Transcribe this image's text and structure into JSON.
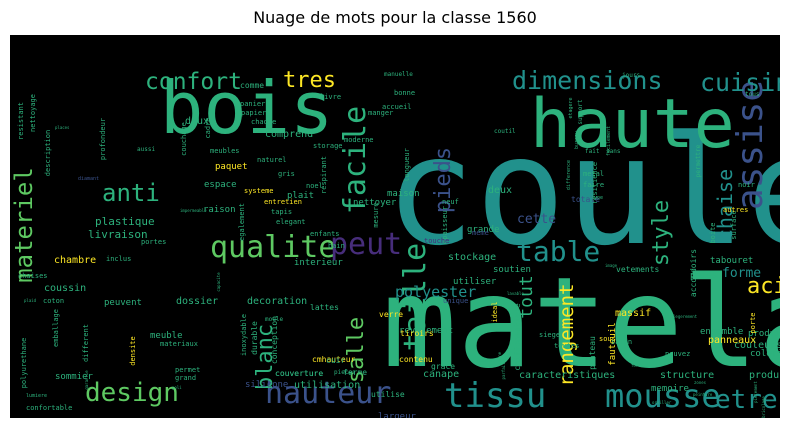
{
  "chart_data": {
    "type": "wordcloud",
    "title": "Nuage de mots pour la classe 1560",
    "background": "#000000",
    "palette": [
      "#2db27d",
      "#21918c",
      "#3b528b",
      "#fde725",
      "#5ec962",
      "#472d7b",
      "#440154"
    ],
    "words": [
      {
        "text": "couleur",
        "weight": 100,
        "color": "#21918c"
      },
      {
        "text": "matelas",
        "weight": 98,
        "color": "#2db27d"
      },
      {
        "text": "bois",
        "weight": 62,
        "color": "#2db27d"
      },
      {
        "text": "haute",
        "weight": 58,
        "color": "#2db27d"
      },
      {
        "text": "tissu",
        "weight": 34,
        "color": "#21918c"
      },
      {
        "text": "mousse",
        "weight": 32,
        "color": "#21918c"
      },
      {
        "text": "hauteur",
        "weight": 30,
        "color": "#3b528b"
      },
      {
        "text": "qualite",
        "weight": 28,
        "color": "#5ec962"
      },
      {
        "text": "table",
        "weight": 28,
        "color": "#21918c"
      },
      {
        "text": "assise",
        "weight": 27,
        "color": "#3b528b"
      },
      {
        "text": "peut",
        "weight": 27,
        "color": "#472d7b"
      },
      {
        "text": "design",
        "weight": 26,
        "color": "#5ec962"
      },
      {
        "text": "etre",
        "weight": 26,
        "color": "#21918c"
      },
      {
        "text": "facile",
        "weight": 24,
        "color": "#2db27d"
      },
      {
        "text": "taille",
        "weight": 24,
        "color": "#2db27d"
      },
      {
        "text": "dimensions",
        "weight": 23,
        "color": "#21918c"
      },
      {
        "text": "cuisine",
        "weight": 23,
        "color": "#21918c"
      },
      {
        "text": "materiel",
        "weight": 22,
        "color": "#5ec962"
      },
      {
        "text": "confort",
        "weight": 21,
        "color": "#2db27d"
      },
      {
        "text": "anti",
        "weight": 21,
        "color": "#2db27d"
      },
      {
        "text": "tres",
        "weight": 21,
        "color": "#fde725"
      },
      {
        "text": "blanc",
        "weight": 20,
        "color": "#2db27d"
      },
      {
        "text": "pieds",
        "weight": 20,
        "color": "#3b528b"
      },
      {
        "text": "salle",
        "weight": 20,
        "color": "#5ec962"
      },
      {
        "text": "acier",
        "weight": 20,
        "color": "#fde725"
      },
      {
        "text": "chaise",
        "weight": 19,
        "color": "#21918c"
      },
      {
        "text": "style",
        "weight": 19,
        "color": "#2db27d"
      },
      {
        "text": "rangement",
        "weight": 18,
        "color": "#fde725"
      },
      {
        "text": "tout",
        "weight": 17,
        "color": "#2db27d"
      },
      {
        "text": "polyester",
        "weight": 14,
        "color": "#21918c"
      },
      {
        "text": "forme",
        "weight": 14,
        "color": "#21918c"
      },
      {
        "text": "cette",
        "weight": 12,
        "color": "#3b528b"
      },
      {
        "text": "plastique",
        "weight": 10,
        "color": "#2db27d"
      },
      {
        "text": "livraison",
        "weight": 10,
        "color": "#2db27d"
      },
      {
        "text": "couleurs",
        "weight": 9,
        "color": "#2db27d"
      },
      {
        "text": "stockage",
        "weight": 9,
        "color": "#2db27d"
      },
      {
        "text": "deux",
        "weight": 9,
        "color": "#2db27d"
      },
      {
        "text": "chambre",
        "weight": 9,
        "color": "#fde725"
      },
      {
        "text": "coussin",
        "weight": 8,
        "color": "#2db27d"
      },
      {
        "text": "comprend",
        "weight": 8,
        "color": "#2db27d"
      },
      {
        "text": "doux",
        "weight": 8,
        "color": "#2db27d"
      },
      {
        "text": "decoration",
        "weight": 8,
        "color": "#2db27d"
      },
      {
        "text": "dossier",
        "weight": 8,
        "color": "#2db27d"
      },
      {
        "text": "produits",
        "weight": 8,
        "color": "#2db27d"
      },
      {
        "text": "structure",
        "weight": 8,
        "color": "#2db27d"
      },
      {
        "text": "caracteristiques",
        "weight": 8,
        "color": "#2db27d"
      },
      {
        "text": "canape",
        "weight": 8,
        "color": "#2db27d"
      },
      {
        "text": "utilisation",
        "weight": 8,
        "color": "#2db27d"
      },
      {
        "text": "memoire",
        "weight": 7,
        "color": "#2db27d"
      },
      {
        "text": "largeur",
        "weight": 7,
        "color": "#3b528b"
      },
      {
        "text": "silicone",
        "weight": 7,
        "color": "#3b528b"
      },
      {
        "text": "revetement",
        "weight": 7,
        "color": "#2db27d"
      },
      {
        "text": "massif",
        "weight": 7,
        "color": "#fde725"
      },
      {
        "text": "panneaux",
        "weight": 7,
        "color": "#fde725"
      },
      {
        "text": "tabouret",
        "weight": 7,
        "color": "#2db27d"
      },
      {
        "text": "meuble",
        "weight": 7,
        "color": "#2db27d"
      },
      {
        "text": "grande",
        "weight": 7,
        "color": "#2db27d"
      },
      {
        "text": "ensemble",
        "weight": 7,
        "color": "#2db27d"
      },
      {
        "text": "coloris",
        "weight": 6,
        "color": "#2db27d"
      },
      {
        "text": "produit",
        "weight": 6,
        "color": "#2db27d"
      },
      {
        "text": "comme",
        "weight": 6,
        "color": "#2db27d"
      },
      {
        "text": "plait",
        "weight": 6,
        "color": "#2db27d"
      },
      {
        "text": "espace",
        "weight": 6,
        "color": "#2db27d"
      },
      {
        "text": "raison",
        "weight": 6,
        "color": "#2db27d"
      },
      {
        "text": "paquet",
        "weight": 6,
        "color": "#fde725"
      },
      {
        "text": "interieur",
        "weight": 6,
        "color": "#2db27d"
      },
      {
        "text": "poids",
        "weight": 6,
        "color": "#2db27d"
      },
      {
        "text": "utiliser",
        "weight": 6,
        "color": "#2db27d"
      },
      {
        "text": "soutien",
        "weight": 6,
        "color": "#2db27d"
      },
      {
        "text": "maison",
        "weight": 6,
        "color": "#2db27d"
      },
      {
        "text": "nettoyer",
        "weight": 6,
        "color": "#2db27d"
      },
      {
        "text": "peuvent",
        "weight": 6,
        "color": "#2db27d"
      },
      {
        "text": "sommier",
        "weight": 6,
        "color": "#2db27d"
      },
      {
        "text": "contenu",
        "weight": 6,
        "color": "#fde725"
      },
      {
        "text": "tiroirs",
        "weight": 6,
        "color": "#fde725"
      },
      {
        "text": "cmhauteur",
        "weight": 6,
        "color": "#fde725"
      },
      {
        "text": "couverture",
        "weight": 6,
        "color": "#2db27d"
      },
      {
        "text": "conception",
        "weight": 6,
        "color": "#2db27d"
      },
      {
        "text": "durable",
        "weight": 6,
        "color": "#2db27d"
      },
      {
        "text": "lattes",
        "weight": 5,
        "color": "#2db27d"
      },
      {
        "text": "verre",
        "weight": 5,
        "color": "#fde725"
      },
      {
        "text": "cuir",
        "weight": 5,
        "color": "#2db27d"
      },
      {
        "text": "grace",
        "weight": 5,
        "color": "#2db27d"
      },
      {
        "text": "ferme",
        "weight": 5,
        "color": "#2db27d"
      },
      {
        "text": "utilise",
        "weight": 5,
        "color": "#2db27d"
      },
      {
        "text": "fauteuil",
        "weight": 5,
        "color": "#fde725"
      },
      {
        "text": "plateau",
        "weight": 5,
        "color": "#2db27d"
      },
      {
        "text": "accoudoirs",
        "weight": 5,
        "color": "#2db27d"
      },
      {
        "text": "vetements",
        "weight": 5,
        "color": "#2db27d"
      },
      {
        "text": "chiffonmatiere",
        "weight": 5,
        "color": "#2db27d"
      },
      {
        "text": "nettoyage",
        "weight": 4,
        "color": "#2db27d"
      },
      {
        "text": "resistant",
        "weight": 4,
        "color": "#2db27d"
      },
      {
        "text": "description",
        "weight": 4,
        "color": "#2db27d"
      },
      {
        "text": "profondeur",
        "weight": 4,
        "color": "#2db27d"
      },
      {
        "text": "couchage",
        "weight": 4,
        "color": "#2db27d"
      },
      {
        "text": "cadre",
        "weight": 4,
        "color": "#2db27d"
      },
      {
        "text": "panier",
        "weight": 4,
        "color": "#2db27d"
      },
      {
        "text": "papier",
        "weight": 4,
        "color": "#2db27d"
      },
      {
        "text": "chaque",
        "weight": 4,
        "color": "#2db27d"
      },
      {
        "text": "livre",
        "weight": 4,
        "color": "#2db27d"
      },
      {
        "text": "manger",
        "weight": 4,
        "color": "#2db27d"
      },
      {
        "text": "bonne",
        "weight": 4,
        "color": "#2db27d"
      },
      {
        "text": "accueil",
        "weight": 4,
        "color": "#2db27d"
      },
      {
        "text": "moderne",
        "weight": 4,
        "color": "#2db27d"
      },
      {
        "text": "storage",
        "weight": 4,
        "color": "#2db27d"
      },
      {
        "text": "respirant",
        "weight": 4,
        "color": "#2db27d"
      },
      {
        "text": "longueur",
        "weight": 4,
        "color": "#2db27d"
      },
      {
        "text": "mesure",
        "weight": 4,
        "color": "#2db27d"
      },
      {
        "text": "epaisseur",
        "weight": 4,
        "color": "#2db27d"
      },
      {
        "text": "resilience",
        "weight": 4,
        "color": "#2db27d"
      },
      {
        "text": "metal",
        "weight": 4,
        "color": "#2db27d"
      },
      {
        "text": "faire",
        "weight": 4,
        "color": "#2db27d"
      },
      {
        "text": "totale",
        "weight": 4,
        "color": "#3b528b"
      },
      {
        "text": "noir",
        "weight": 4,
        "color": "#2db27d"
      },
      {
        "text": "surface",
        "weight": 4,
        "color": "#2db27d"
      },
      {
        "text": "boite",
        "weight": 4,
        "color": "#2db27d"
      },
      {
        "text": "autres",
        "weight": 4,
        "color": "#fde725"
      },
      {
        "text": "meubles",
        "weight": 4,
        "color": "#2db27d"
      },
      {
        "text": "naturel",
        "weight": 4,
        "color": "#2db27d"
      },
      {
        "text": "gris",
        "weight": 4,
        "color": "#2db27d"
      },
      {
        "text": "noel",
        "weight": 4,
        "color": "#2db27d"
      },
      {
        "text": "systeme",
        "weight": 4,
        "color": "#fde725"
      },
      {
        "text": "entretien",
        "weight": 4,
        "color": "#fde725"
      },
      {
        "text": "tapis",
        "weight": 4,
        "color": "#2db27d"
      },
      {
        "text": "elegant",
        "weight": 4,
        "color": "#2db27d"
      },
      {
        "text": "enfants",
        "weight": 4,
        "color": "#2db27d"
      },
      {
        "text": "bain",
        "weight": 4,
        "color": "#2db27d"
      },
      {
        "text": "neuf",
        "weight": 4,
        "color": "#2db27d"
      },
      {
        "text": "meme",
        "weight": 4,
        "color": "#3b528b"
      },
      {
        "text": "touche",
        "weight": 4,
        "color": "#472d7b"
      },
      {
        "text": "inclus",
        "weight": 4,
        "color": "#2db27d"
      },
      {
        "text": "egalement",
        "weight": 4,
        "color": "#2db27d"
      },
      {
        "text": "portes",
        "weight": 4,
        "color": "#2db27d"
      },
      {
        "text": "chaises",
        "weight": 4,
        "color": "#2db27d"
      },
      {
        "text": "coton",
        "weight": 4,
        "color": "#2db27d"
      },
      {
        "text": "polyurethane",
        "weight": 4,
        "color": "#2db27d"
      },
      {
        "text": "emballage",
        "weight": 4,
        "color": "#2db27d"
      },
      {
        "text": "different",
        "weight": 4,
        "color": "#2db27d"
      },
      {
        "text": "materiaux",
        "weight": 4,
        "color": "#2db27d"
      },
      {
        "text": "densite",
        "weight": 4,
        "color": "#fde725"
      },
      {
        "text": "inoxydable",
        "weight": 4,
        "color": "#2db27d"
      },
      {
        "text": "permet",
        "weight": 4,
        "color": "#2db27d"
      },
      {
        "text": "grand",
        "weight": 4,
        "color": "#2db27d"
      },
      {
        "text": "confortable",
        "weight": 4,
        "color": "#2db27d"
      },
      {
        "text": "unique",
        "weight": 4,
        "color": "#3b528b"
      },
      {
        "text": "sous",
        "weight": 4,
        "color": "#fde725"
      },
      {
        "text": "siege",
        "weight": 4,
        "color": "#2db27d"
      },
      {
        "text": "ideal",
        "weight": 4,
        "color": "#fde725"
      },
      {
        "text": "toutes",
        "weight": 4,
        "color": "#2db27d"
      },
      {
        "text": "salon",
        "weight": 4,
        "color": "#2db27d"
      },
      {
        "text": "pouvez",
        "weight": 4,
        "color": "#2db27d"
      },
      {
        "text": "porte",
        "weight": 4,
        "color": "#fde725"
      },
      {
        "text": "manuelle",
        "weight": 3,
        "color": "#2db27d"
      },
      {
        "text": "support",
        "weight": 3,
        "color": "#2db27d"
      },
      {
        "text": "coutil",
        "weight": 3,
        "color": "#2db27d"
      },
      {
        "text": "jours",
        "weight": 3,
        "color": "#2db27d"
      },
      {
        "text": "tous",
        "weight": 3,
        "color": "#2db27d"
      },
      {
        "text": "fait",
        "weight": 3,
        "color": "#2db27d"
      },
      {
        "text": "permettre",
        "weight": 3,
        "color": "#2db27d"
      },
      {
        "text": "sans",
        "weight": 3,
        "color": "#2db27d"
      },
      {
        "text": "etagere",
        "weight": 3,
        "color": "#2db27d"
      },
      {
        "text": "bureau",
        "weight": 3,
        "color": "#2db27d"
      },
      {
        "text": "facilement",
        "weight": 3,
        "color": "#2db27d"
      },
      {
        "text": "difference",
        "weight": 3,
        "color": "#2db27d"
      },
      {
        "text": "type",
        "weight": 3,
        "color": "#2db27d"
      },
      {
        "text": "pieces",
        "weight": 3,
        "color": "#2db27d"
      },
      {
        "text": "moule",
        "weight": 3,
        "color": "#2db27d"
      },
      {
        "text": "aussi",
        "weight": 3,
        "color": "#2db27d"
      },
      {
        "text": "places",
        "weight": 2,
        "color": "#2db27d"
      },
      {
        "text": "diamant",
        "weight": 2,
        "color": "#3b528b"
      },
      {
        "text": "lumiere",
        "weight": 2,
        "color": "#2db27d"
      },
      {
        "text": "garantie",
        "weight": 2,
        "color": "#2db27d"
      },
      {
        "text": "poli",
        "weight": 2,
        "color": "#2db27d"
      },
      {
        "text": "chene",
        "weight": 2,
        "color": "#2db27d"
      },
      {
        "text": "parfait",
        "weight": 2,
        "color": "#2db27d"
      },
      {
        "text": "forfait",
        "weight": 2,
        "color": "#2db27d"
      },
      {
        "text": "oreiller",
        "weight": 2,
        "color": "#2db27d"
      },
      {
        "text": "bricolage",
        "weight": 2,
        "color": "#2db27d"
      },
      {
        "text": "pietement",
        "weight": 2,
        "color": "#2db27d"
      },
      {
        "text": "peinture",
        "weight": 2,
        "color": "#2db27d"
      },
      {
        "text": "zones",
        "weight": 2,
        "color": "#2db27d"
      },
      {
        "text": "image",
        "weight": 2,
        "color": "#2db27d"
      },
      {
        "text": "couverture",
        "weight": 2,
        "color": "#2db27d"
      },
      {
        "text": "particules",
        "weight": 2,
        "color": "#2db27d"
      },
      {
        "text": "legerement",
        "weight": 2,
        "color": "#2db27d"
      },
      {
        "text": "plaid",
        "weight": 2,
        "color": "#2db27d"
      },
      {
        "text": "capacite",
        "weight": 2,
        "color": "#2db27d"
      },
      {
        "text": "impermeable",
        "weight": 2,
        "color": "#2db27d"
      },
      {
        "text": "cadeau",
        "weight": 2,
        "color": "#2db27d"
      },
      {
        "text": "lavable",
        "weight": 2,
        "color": "#2db27d"
      }
    ]
  }
}
